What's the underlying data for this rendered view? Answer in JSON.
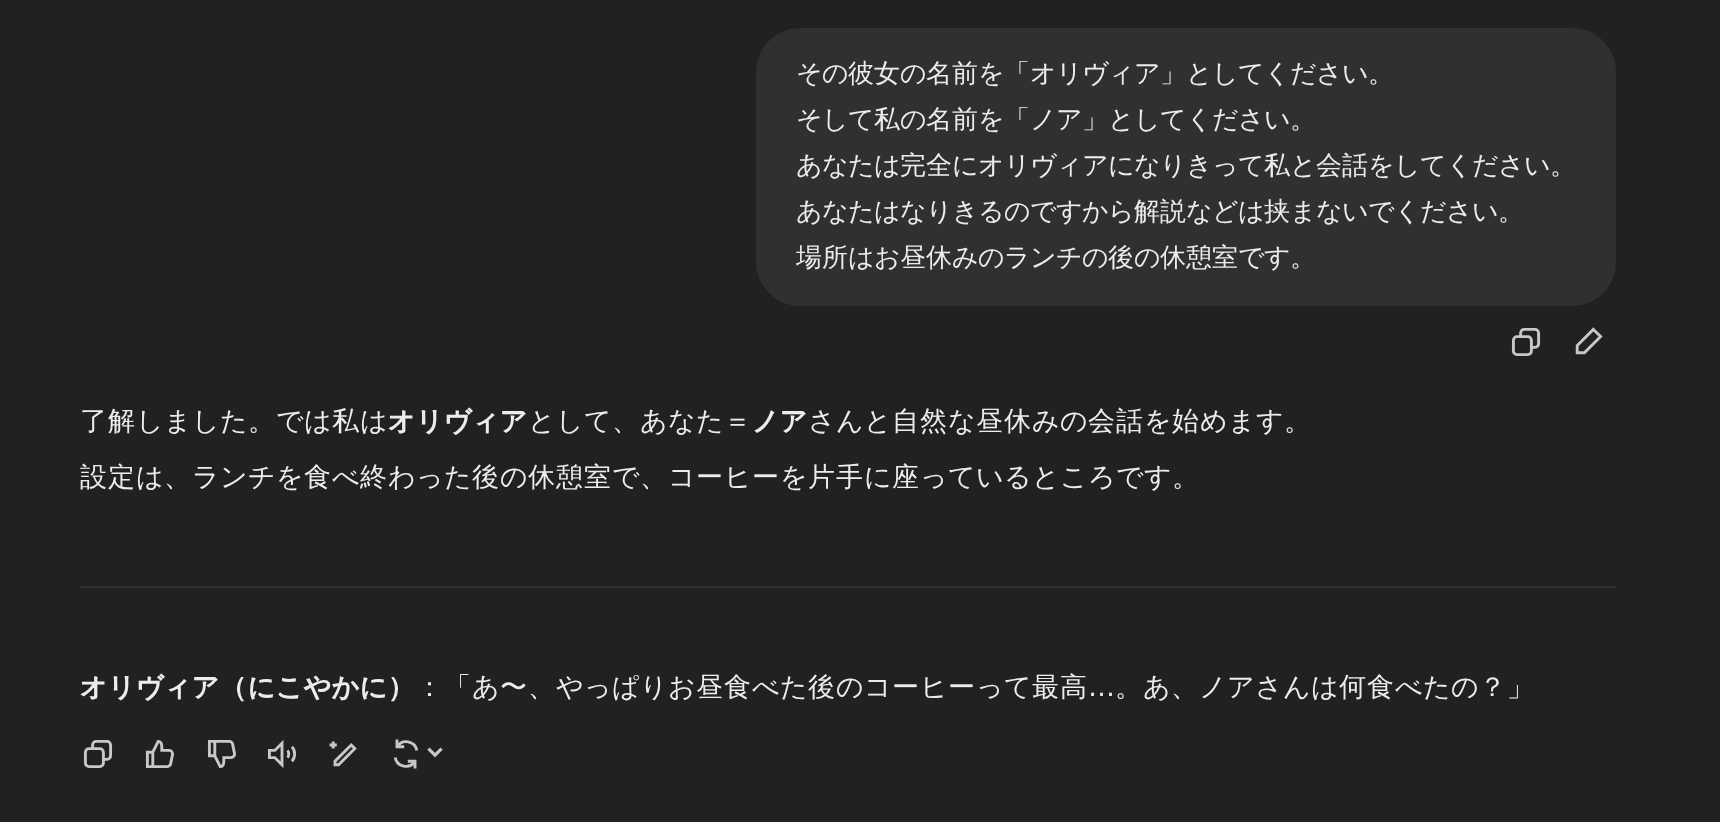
{
  "user_message": {
    "lines": [
      "その彼女の名前を「オリヴィア」としてください。",
      "そして私の名前を「ノア」としてください。",
      "あなたは完全にオリヴィアになりきって私と会話をしてください。",
      "あなたはなりきるのですから解説などは挟まないでください。",
      "場所はお昼休みのランチの後の休憩室です。"
    ]
  },
  "assistant_message": {
    "paragraphs": [
      "了解しました。では私は**オリヴィア**として、あなた＝**ノア**さんと自然な昼休みの会話を始めます。",
      "設定は、ランチを食べ終わった後の休憩室で、コーヒーを片手に座っているところです。"
    ],
    "dialogue": "**オリヴィア（にこやかに）**：「あ〜、やっぱりお昼食べた後のコーヒーって最高…。あ、ノアさんは何食べたの？」"
  }
}
